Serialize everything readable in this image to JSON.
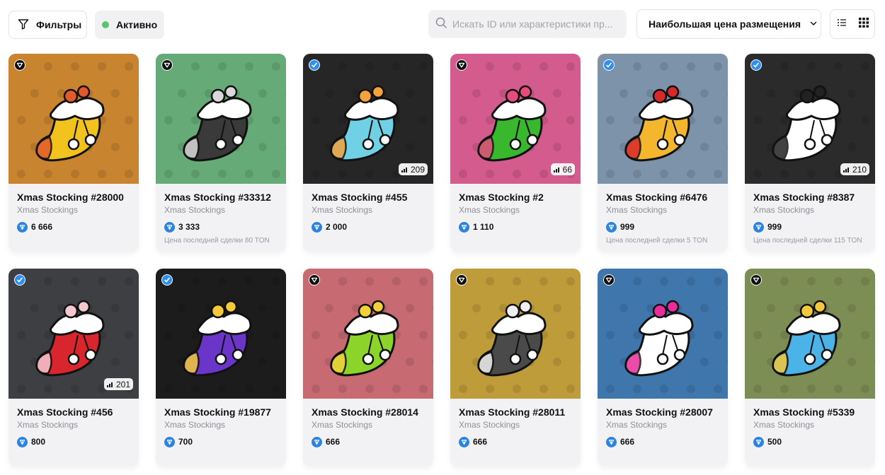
{
  "toolbar": {
    "filters_label": "Фильтры",
    "active_label": "Активно",
    "search_placeholder": "Искать ID или характеристики пр...",
    "sort_label": "Наибольшая цена размещения"
  },
  "cards": [
    {
      "title": "Xmas Stocking #28000",
      "collection": "Xmas Stockings",
      "price": "6 666",
      "last_deal": "",
      "rank": "",
      "badge": "dark",
      "bg": "#c8842f",
      "sock": "#f2c31d",
      "accent": "#e25a2a"
    },
    {
      "title": "Xmas Stocking #33312",
      "collection": "Xmas Stockings",
      "price": "3 333",
      "last_deal": "Цена последней сделки 80 TON",
      "rank": "",
      "badge": "dark",
      "bg": "#66ab77",
      "sock": "#3a3a3a",
      "accent": "#d9d9d9"
    },
    {
      "title": "Xmas Stocking #455",
      "collection": "Xmas Stockings",
      "price": "2 000",
      "last_deal": "",
      "rank": "209",
      "badge": "blue",
      "bg": "#262626",
      "sock": "#6fd0e6",
      "accent": "#f3a23c"
    },
    {
      "title": "Xmas Stocking #2",
      "collection": "Xmas Stockings",
      "price": "1 110",
      "last_deal": "",
      "rank": "66",
      "badge": "dark",
      "bg": "#d45b8d",
      "sock": "#39b82e",
      "accent": "#e54c7c"
    },
    {
      "title": "Xmas Stocking #6476",
      "collection": "Xmas Stockings",
      "price": "999",
      "last_deal": "Цена последней сделки 5 TON",
      "rank": "",
      "badge": "blue",
      "bg": "#7d93aa",
      "sock": "#f3b62c",
      "accent": "#d8282a"
    },
    {
      "title": "Xmas Stocking #8387",
      "collection": "Xmas Stockings",
      "price": "999",
      "last_deal": "Цена последней сделки 115 TON",
      "rank": "210",
      "badge": "blue",
      "bg": "#2b2b2b",
      "sock": "#ffffff",
      "accent": "#222222"
    },
    {
      "title": "Xmas Stocking #456",
      "collection": "Xmas Stockings",
      "price": "800",
      "last_deal": "",
      "rank": "201",
      "badge": "blue",
      "bg": "#3d3f43",
      "sock": "#d8252e",
      "accent": "#f5c7cf"
    },
    {
      "title": "Xmas Stocking #19877",
      "collection": "Xmas Stockings",
      "price": "700",
      "last_deal": "",
      "rank": "",
      "badge": "blue",
      "bg": "#1c1c1c",
      "sock": "#6b35c9",
      "accent": "#f4c93a"
    },
    {
      "title": "Xmas Stocking #28014",
      "collection": "Xmas Stockings",
      "price": "666",
      "last_deal": "",
      "rank": "",
      "badge": "dark",
      "bg": "#c76a72",
      "sock": "#8cd42a",
      "accent": "#f0d13a"
    },
    {
      "title": "Xmas Stocking #28011",
      "collection": "Xmas Stockings",
      "price": "666",
      "last_deal": "",
      "rank": "",
      "badge": "dark",
      "bg": "#bf9c3a",
      "sock": "#4a4a4a",
      "accent": "#efefef"
    },
    {
      "title": "Xmas Stocking #28007",
      "collection": "Xmas Stockings",
      "price": "666",
      "last_deal": "",
      "rank": "",
      "badge": "dark",
      "bg": "#3f77ad",
      "sock": "#ffffff",
      "accent": "#ea2c9b"
    },
    {
      "title": "Xmas Stocking #5339",
      "collection": "Xmas Stockings",
      "price": "500",
      "last_deal": "",
      "rank": "",
      "badge": "dark",
      "bg": "#7d8e55",
      "sock": "#4bb3e8",
      "accent": "#f3c83a"
    }
  ]
}
